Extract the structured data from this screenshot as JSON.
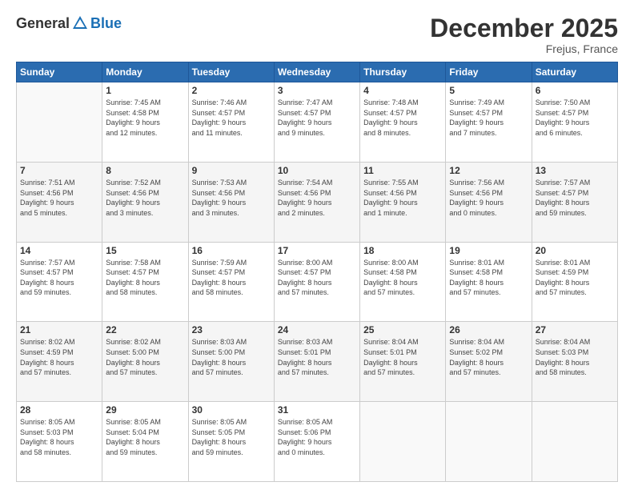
{
  "logo": {
    "general": "General",
    "blue": "Blue"
  },
  "header": {
    "month": "December 2025",
    "location": "Frejus, France"
  },
  "days_of_week": [
    "Sunday",
    "Monday",
    "Tuesday",
    "Wednesday",
    "Thursday",
    "Friday",
    "Saturday"
  ],
  "weeks": [
    [
      {
        "day": "",
        "info": ""
      },
      {
        "day": "1",
        "info": "Sunrise: 7:45 AM\nSunset: 4:58 PM\nDaylight: 9 hours\nand 12 minutes."
      },
      {
        "day": "2",
        "info": "Sunrise: 7:46 AM\nSunset: 4:57 PM\nDaylight: 9 hours\nand 11 minutes."
      },
      {
        "day": "3",
        "info": "Sunrise: 7:47 AM\nSunset: 4:57 PM\nDaylight: 9 hours\nand 9 minutes."
      },
      {
        "day": "4",
        "info": "Sunrise: 7:48 AM\nSunset: 4:57 PM\nDaylight: 9 hours\nand 8 minutes."
      },
      {
        "day": "5",
        "info": "Sunrise: 7:49 AM\nSunset: 4:57 PM\nDaylight: 9 hours\nand 7 minutes."
      },
      {
        "day": "6",
        "info": "Sunrise: 7:50 AM\nSunset: 4:57 PM\nDaylight: 9 hours\nand 6 minutes."
      }
    ],
    [
      {
        "day": "7",
        "info": "Sunrise: 7:51 AM\nSunset: 4:56 PM\nDaylight: 9 hours\nand 5 minutes."
      },
      {
        "day": "8",
        "info": "Sunrise: 7:52 AM\nSunset: 4:56 PM\nDaylight: 9 hours\nand 3 minutes."
      },
      {
        "day": "9",
        "info": "Sunrise: 7:53 AM\nSunset: 4:56 PM\nDaylight: 9 hours\nand 3 minutes."
      },
      {
        "day": "10",
        "info": "Sunrise: 7:54 AM\nSunset: 4:56 PM\nDaylight: 9 hours\nand 2 minutes."
      },
      {
        "day": "11",
        "info": "Sunrise: 7:55 AM\nSunset: 4:56 PM\nDaylight: 9 hours\nand 1 minute."
      },
      {
        "day": "12",
        "info": "Sunrise: 7:56 AM\nSunset: 4:56 PM\nDaylight: 9 hours\nand 0 minutes."
      },
      {
        "day": "13",
        "info": "Sunrise: 7:57 AM\nSunset: 4:57 PM\nDaylight: 8 hours\nand 59 minutes."
      }
    ],
    [
      {
        "day": "14",
        "info": "Sunrise: 7:57 AM\nSunset: 4:57 PM\nDaylight: 8 hours\nand 59 minutes."
      },
      {
        "day": "15",
        "info": "Sunrise: 7:58 AM\nSunset: 4:57 PM\nDaylight: 8 hours\nand 58 minutes."
      },
      {
        "day": "16",
        "info": "Sunrise: 7:59 AM\nSunset: 4:57 PM\nDaylight: 8 hours\nand 58 minutes."
      },
      {
        "day": "17",
        "info": "Sunrise: 8:00 AM\nSunset: 4:57 PM\nDaylight: 8 hours\nand 57 minutes."
      },
      {
        "day": "18",
        "info": "Sunrise: 8:00 AM\nSunset: 4:58 PM\nDaylight: 8 hours\nand 57 minutes."
      },
      {
        "day": "19",
        "info": "Sunrise: 8:01 AM\nSunset: 4:58 PM\nDaylight: 8 hours\nand 57 minutes."
      },
      {
        "day": "20",
        "info": "Sunrise: 8:01 AM\nSunset: 4:59 PM\nDaylight: 8 hours\nand 57 minutes."
      }
    ],
    [
      {
        "day": "21",
        "info": "Sunrise: 8:02 AM\nSunset: 4:59 PM\nDaylight: 8 hours\nand 57 minutes."
      },
      {
        "day": "22",
        "info": "Sunrise: 8:02 AM\nSunset: 5:00 PM\nDaylight: 8 hours\nand 57 minutes."
      },
      {
        "day": "23",
        "info": "Sunrise: 8:03 AM\nSunset: 5:00 PM\nDaylight: 8 hours\nand 57 minutes."
      },
      {
        "day": "24",
        "info": "Sunrise: 8:03 AM\nSunset: 5:01 PM\nDaylight: 8 hours\nand 57 minutes."
      },
      {
        "day": "25",
        "info": "Sunrise: 8:04 AM\nSunset: 5:01 PM\nDaylight: 8 hours\nand 57 minutes."
      },
      {
        "day": "26",
        "info": "Sunrise: 8:04 AM\nSunset: 5:02 PM\nDaylight: 8 hours\nand 57 minutes."
      },
      {
        "day": "27",
        "info": "Sunrise: 8:04 AM\nSunset: 5:03 PM\nDaylight: 8 hours\nand 58 minutes."
      }
    ],
    [
      {
        "day": "28",
        "info": "Sunrise: 8:05 AM\nSunset: 5:03 PM\nDaylight: 8 hours\nand 58 minutes."
      },
      {
        "day": "29",
        "info": "Sunrise: 8:05 AM\nSunset: 5:04 PM\nDaylight: 8 hours\nand 59 minutes."
      },
      {
        "day": "30",
        "info": "Sunrise: 8:05 AM\nSunset: 5:05 PM\nDaylight: 8 hours\nand 59 minutes."
      },
      {
        "day": "31",
        "info": "Sunrise: 8:05 AM\nSunset: 5:06 PM\nDaylight: 9 hours\nand 0 minutes."
      },
      {
        "day": "",
        "info": ""
      },
      {
        "day": "",
        "info": ""
      },
      {
        "day": "",
        "info": ""
      }
    ]
  ]
}
